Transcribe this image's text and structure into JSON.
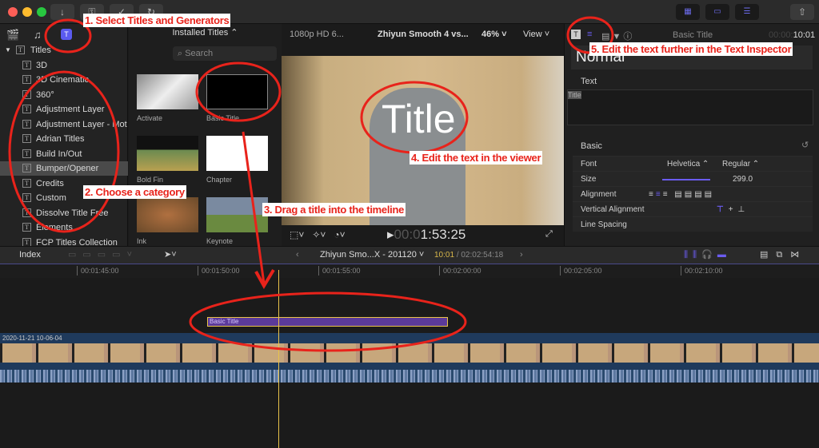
{
  "toolbar": {
    "icons": [
      "import-icon",
      "keywords-icon",
      "background-tasks-icon",
      "share-icon"
    ],
    "view_buttons": [
      "browser-layout",
      "timeline-layout",
      "inspector-layout"
    ]
  },
  "browser": {
    "title_selector": "Installed Titles ⌃",
    "search_placeholder": "Search",
    "categories": [
      {
        "label": "Titles",
        "root": true
      },
      {
        "label": "3D"
      },
      {
        "label": "3D Cinematic"
      },
      {
        "label": "360°"
      },
      {
        "label": "Adjustment Layer"
      },
      {
        "label": "Adjustment Layer - Mot"
      },
      {
        "label": "Adrian Titles"
      },
      {
        "label": "Build In/Out"
      },
      {
        "label": "Bumper/Opener",
        "selected": true
      },
      {
        "label": "Credits"
      },
      {
        "label": "Custom"
      },
      {
        "label": "Dissolve Title Free"
      },
      {
        "label": "Elements"
      },
      {
        "label": "FCP Titles Collection"
      }
    ],
    "thumbnails": [
      {
        "label": "Activate"
      },
      {
        "label": "Basic Title"
      },
      {
        "label": "Bold Fin"
      },
      {
        "label": "Chapter"
      },
      {
        "label": "Ink"
      },
      {
        "label": "Keynote"
      }
    ]
  },
  "viewer": {
    "format": "1080p HD 6...",
    "project": "Zhiyun Smooth 4 vs...",
    "zoom": "46%",
    "view_label": "View",
    "title_overlay": "Title",
    "timecode_dim": "00:0",
    "timecode": "1:53:25"
  },
  "inspector": {
    "clip_name": "Basic Title",
    "timecode_dim": "00:00:",
    "timecode": "10:01",
    "preset": "Normal",
    "text_section": "Text",
    "text_value": "Title",
    "basic_section": "Basic",
    "rows": {
      "font_label": "Font",
      "font_value": "Helvetica ⌃",
      "font_style": "Regular ⌃",
      "size_label": "Size",
      "size_value": "299.0",
      "alignment_label": "Alignment",
      "valign_label": "Vertical Alignment",
      "line_spacing_label": "Line Spacing"
    },
    "size_slider_fraction": 0.95
  },
  "timeline": {
    "index_label": "Index",
    "project": "Zhiyun Smo...X - 201120",
    "current": "10:01",
    "duration": "/ 02:02:54:18",
    "ruler": [
      "00:01:45:00",
      "00:01:50:00",
      "00:01:55:00",
      "00:02:00:00",
      "00:02:05:00",
      "00:02:10:00"
    ],
    "title_clip": "Basic Title",
    "video_clip": "2020-11-21 10-06-04"
  },
  "annotations": {
    "a1": "1. Select Titles and Generators",
    "a2": "2. Choose a category",
    "a3": "3. Drag a title into the timeline",
    "a4": "4. Edit the text in the viewer",
    "a5": "5. Edit the text further in the Text Inspector"
  },
  "colors": {
    "accent": "#6b5cf0",
    "annotation": "#e8231b",
    "title_clip": "#5b3a9a",
    "playhead": "#e8c24a"
  }
}
